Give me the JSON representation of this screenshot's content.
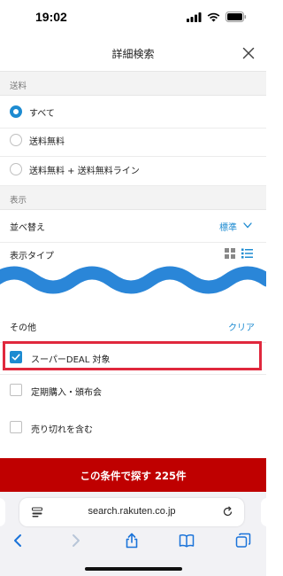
{
  "status_bar": {
    "time": "19:02"
  },
  "header": {
    "title": "詳細検索"
  },
  "shipping": {
    "section_label": "送料",
    "options": [
      {
        "label": "すべて",
        "selected": true
      },
      {
        "label": "送料無料",
        "selected": false
      },
      {
        "label": "送料無料 + 送料無料ライン",
        "selected": false
      }
    ]
  },
  "display": {
    "section_label": "表示",
    "sort_label": "並べ替え",
    "sort_value": "標準",
    "display_type_label": "表示タイプ"
  },
  "other": {
    "label": "その他",
    "clear_label": "クリア",
    "options": [
      {
        "label": "スーパーDEAL 対象",
        "checked": true
      },
      {
        "label": "定期購入・頒布会",
        "checked": false
      },
      {
        "label": "売り切れを含む",
        "checked": false
      }
    ]
  },
  "cta": {
    "label": "この条件で探す 225件"
  },
  "browser": {
    "url": "search.rakuten.co.jp"
  },
  "colors": {
    "accent": "#1d8bd1",
    "brand_red": "#bf0000",
    "highlight": "#e0283d"
  }
}
